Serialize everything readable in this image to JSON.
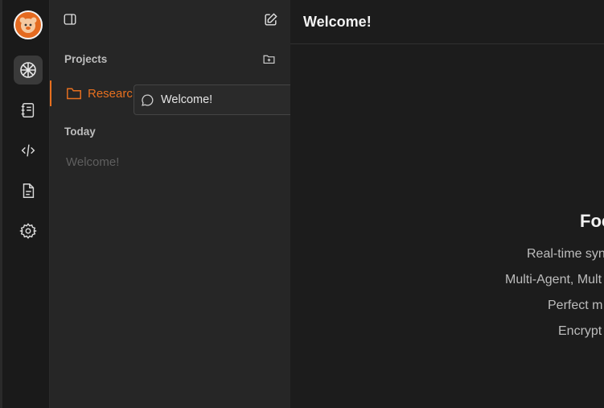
{
  "sidebar": {
    "projects_label": "Projects",
    "today_label": "Today",
    "project_name": "Researc",
    "chat_items": [
      "Welcome!"
    ]
  },
  "tooltip": {
    "text": "Welcome!"
  },
  "main": {
    "title": "Welcome!",
    "hero_title": "Foc",
    "features": [
      "Real-time syn",
      "Multi-Agent, Mult",
      "Perfect m",
      "Encrypt"
    ]
  },
  "colors": {
    "accent": "#e8701f",
    "background": "#1c1c1c",
    "sidebar": "#262626"
  },
  "icons": [
    "avatar-logo",
    "ai-brain-icon",
    "notebook-icon",
    "code-pen-icon",
    "document-icon",
    "settings-icon",
    "panel-toggle-icon",
    "new-chat-icon",
    "new-folder-icon",
    "folder-icon",
    "chat-bubble-icon"
  ]
}
